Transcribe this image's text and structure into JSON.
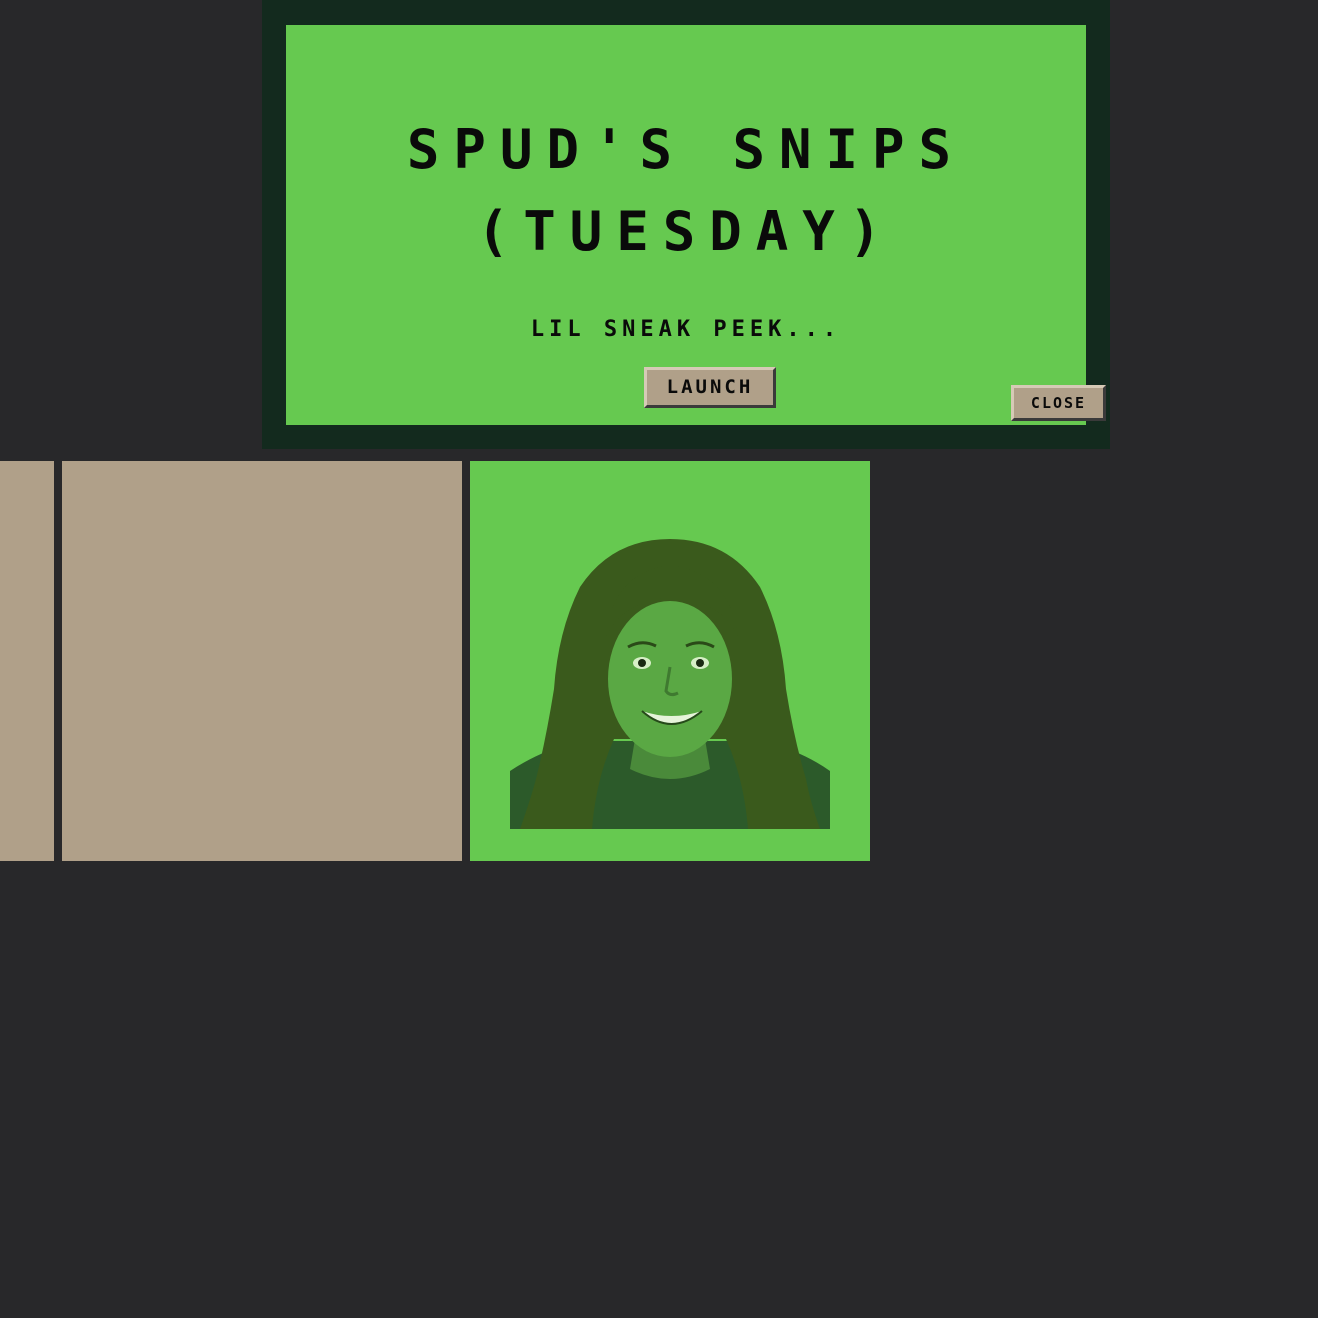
{
  "popup": {
    "title_line1": "SPUD'S SNIPS",
    "title_line2": "(TUESDAY)",
    "subtitle": "LIL SNEAK PEEK...",
    "launch_label": "LAUNCH",
    "close_label": "CLOSE"
  },
  "tiles": [
    {
      "kind": "blank",
      "color": "#b0a089"
    },
    {
      "kind": "blank",
      "color": "#b0a089"
    },
    {
      "kind": "portrait",
      "color": "#66c950"
    }
  ],
  "colors": {
    "background": "#28282a",
    "popup_frame": "#132a1e",
    "accent_green": "#66c950",
    "button_tan": "#b0a089",
    "text": "#0a0a0a"
  }
}
